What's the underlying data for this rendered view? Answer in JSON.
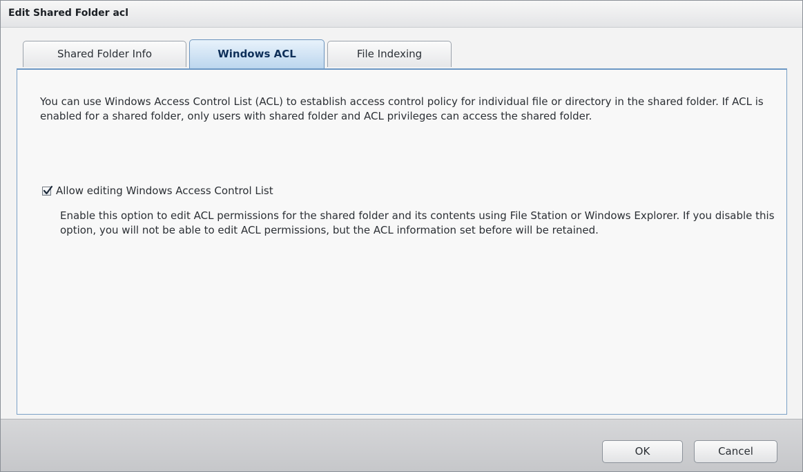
{
  "dialog": {
    "title": "Edit Shared Folder acl"
  },
  "tabs": [
    {
      "label": "Shared Folder Info",
      "active": false
    },
    {
      "label": "Windows ACL",
      "active": true
    },
    {
      "label": "File Indexing",
      "active": false
    }
  ],
  "panel": {
    "description": "You can use Windows Access Control List (ACL) to establish access control policy for individual file or directory in the shared folder. If ACL is enabled for a shared folder, only users with shared folder and ACL privileges can access the shared folder.",
    "option": {
      "label": "Allow editing Windows Access Control List",
      "checked": true,
      "description": "Enable this option to edit ACL permissions for the shared folder and its contents using File Station or Windows Explorer. If you disable this option, you will not be able to edit ACL permissions, but the ACL information set before will be retained."
    }
  },
  "footer": {
    "ok_label": "OK",
    "cancel_label": "Cancel"
  },
  "colors": {
    "active_tab": "#bcd6ee",
    "panel_border": "#6b97c4"
  },
  "icons": {
    "checkbox": "checkmark-icon"
  }
}
